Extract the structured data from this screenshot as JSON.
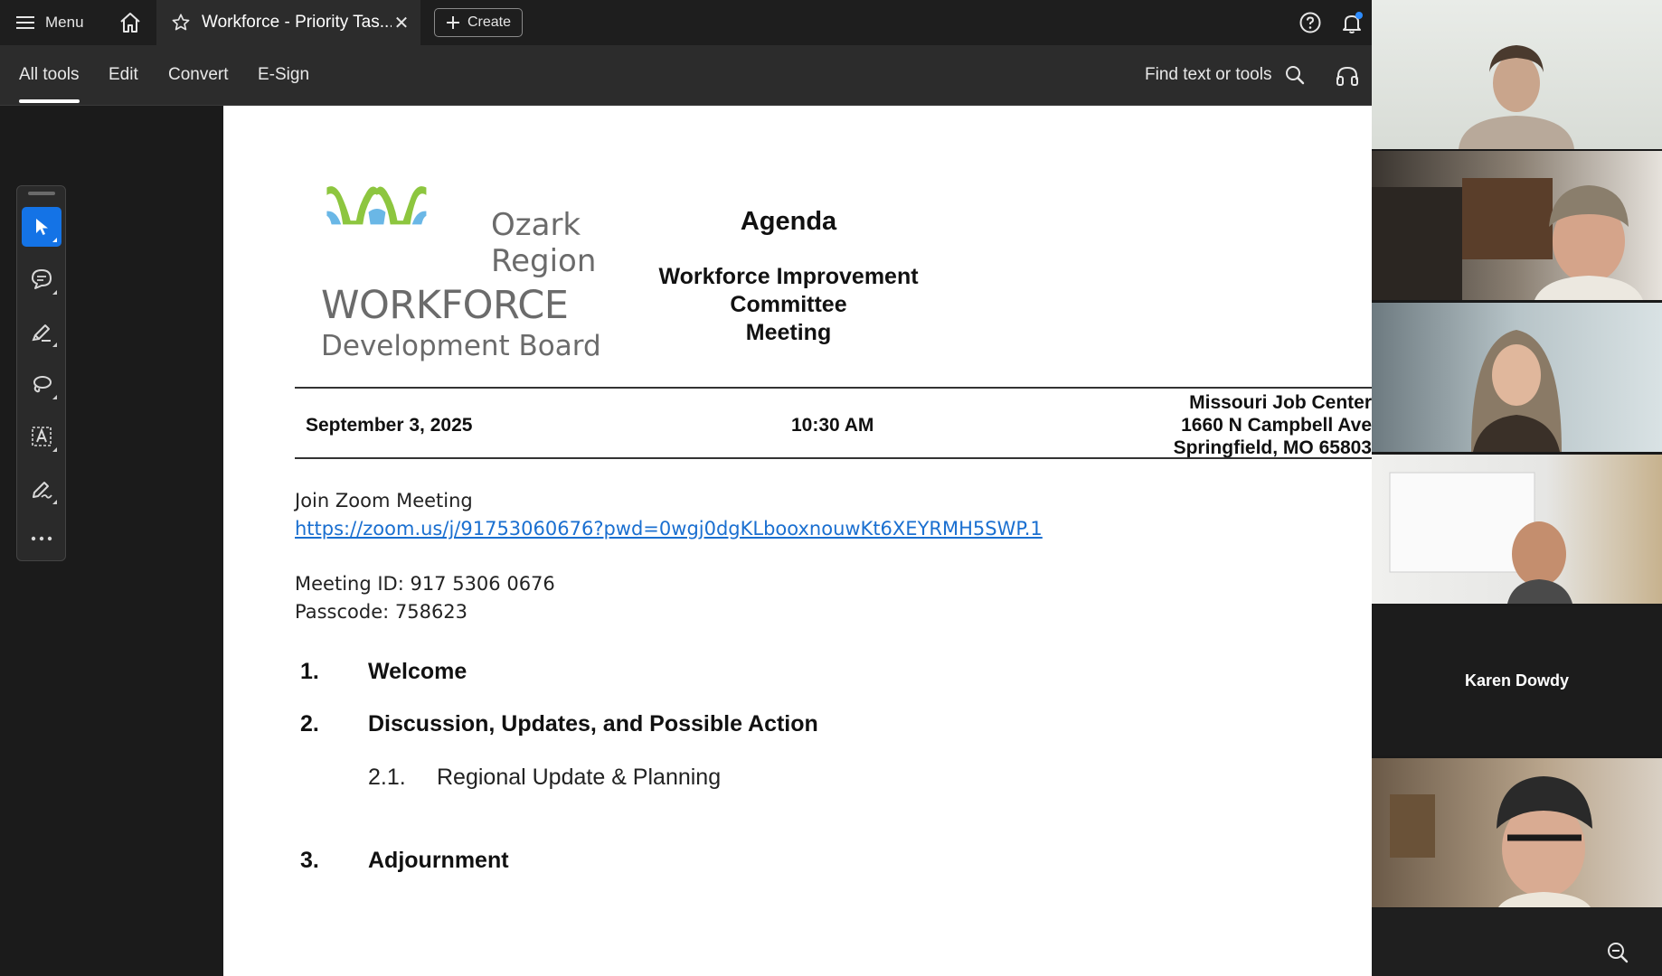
{
  "topbar": {
    "menu_label": "Menu",
    "tab_title": "Workforce - Priority Tas...",
    "create_label": "Create"
  },
  "menubar": {
    "tabs": [
      "All tools",
      "Edit",
      "Convert",
      "E-Sign"
    ],
    "find_label": "Find text or tools"
  },
  "document": {
    "logo": {
      "line1": "Ozark",
      "line2": "Region",
      "big": "WORKFORCE",
      "sub": "Development Board",
      "colors": {
        "green": "#8dc63f",
        "blue": "#6ab7e6",
        "gray": "#6b6b6b"
      }
    },
    "title": "Agenda",
    "committee_line1": "Workforce Improvement Committee",
    "committee_line2": "Meeting",
    "date": "September 3, 2025",
    "time": "10:30 AM",
    "address_line1": "Missouri Job Center",
    "address_line2": "1660 N Campbell Ave",
    "address_line3": "Springfield, MO 65803",
    "join_text": "Join Zoom Meeting",
    "zoom_link": "https://zoom.us/j/91753060676?pwd=0wgj0dgKLbooxnouwKt6XEYRMH5SWP.1",
    "meeting_id": "Meeting ID: 917 5306 0676",
    "passcode": "Passcode: 758623",
    "items": [
      {
        "num": "1.",
        "label": "Welcome"
      },
      {
        "num": "2.",
        "label": "Discussion, Updates, and Possible Action"
      },
      {
        "num": "3.",
        "label": "Adjournment"
      }
    ],
    "subitem": {
      "num": "2.1.",
      "label": "Regional Update & Planning"
    }
  },
  "participants": {
    "name_tile": "Karen Dowdy"
  },
  "colors": {
    "accent": "#1473e6",
    "link": "#1a6fd0",
    "notification": "#2d8cff"
  }
}
